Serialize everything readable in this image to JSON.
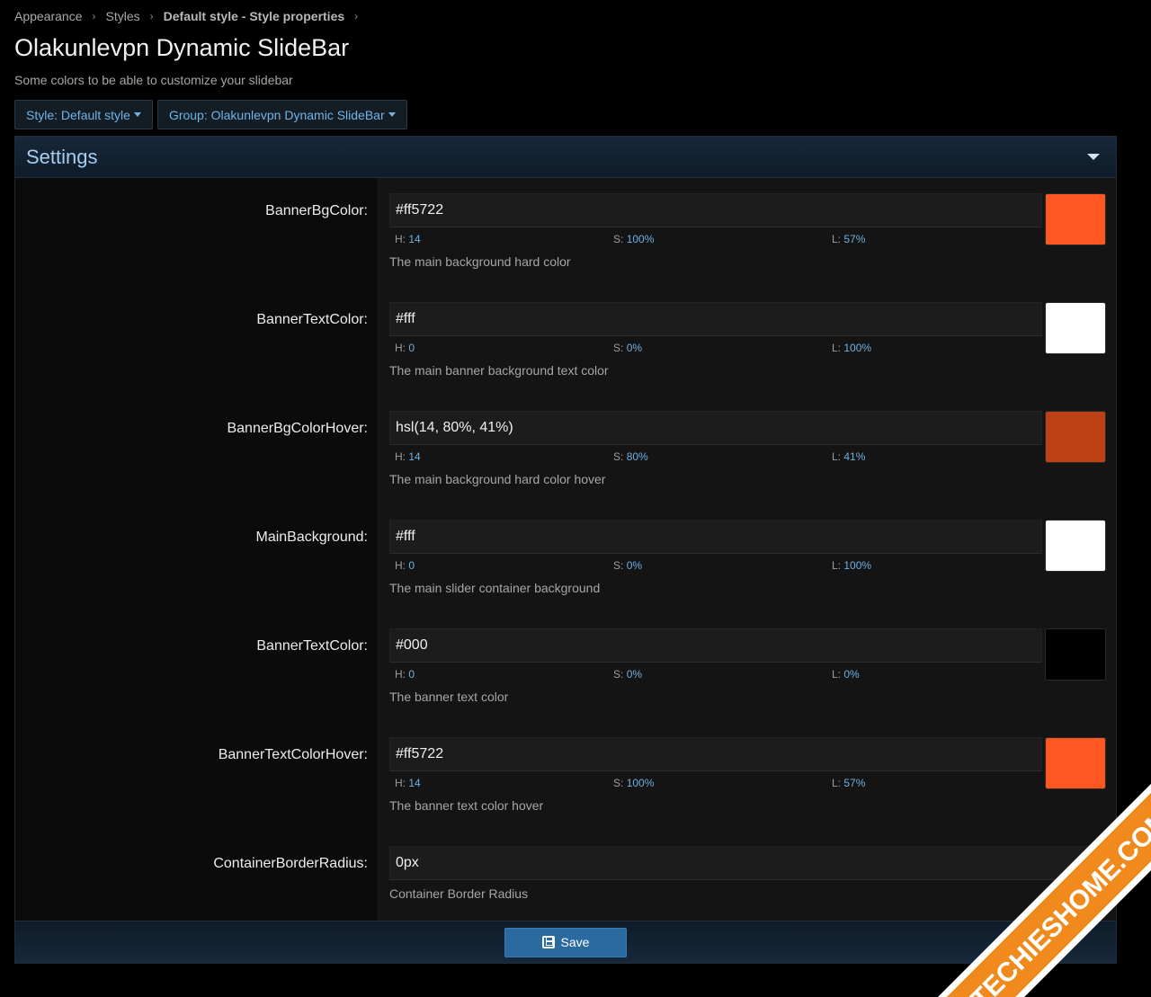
{
  "breadcrumb": {
    "items": [
      "Appearance",
      "Styles",
      "Default style - Style properties"
    ]
  },
  "page": {
    "title": "Olakunlevpn Dynamic SlideBar",
    "description": "Some colors to be able to customize your slidebar"
  },
  "filters": {
    "style": "Style: Default style",
    "group": "Group: Olakunlevpn Dynamic SlideBar"
  },
  "settings": {
    "title": "Settings",
    "rows": [
      {
        "label": "BannerBgColor:",
        "value": "#ff5722",
        "h_label": "H:",
        "h": "14",
        "s_label": "S:",
        "s": "100%",
        "l_label": "L:",
        "l": "57%",
        "swatch": "#ff5722",
        "explain": "The main background hard color"
      },
      {
        "label": "BannerTextColor:",
        "value": "#fff",
        "h_label": "H:",
        "h": "0",
        "s_label": "S:",
        "s": "0%",
        "l_label": "L:",
        "l": "100%",
        "swatch": "#ffffff",
        "explain": "The main banner background text color"
      },
      {
        "label": "BannerBgColorHover:",
        "value": "hsl(14, 80%, 41%)",
        "h_label": "H:",
        "h": "14",
        "s_label": "S:",
        "s": "80%",
        "l_label": "L:",
        "l": "41%",
        "swatch": "#bd4115",
        "explain": "The main background hard color hover"
      },
      {
        "label": "MainBackground:",
        "value": "#fff",
        "h_label": "H:",
        "h": "0",
        "s_label": "S:",
        "s": "0%",
        "l_label": "L:",
        "l": "100%",
        "swatch": "#ffffff",
        "explain": "The main slider container background"
      },
      {
        "label": "BannerTextColor:",
        "value": "#000",
        "h_label": "H:",
        "h": "0",
        "s_label": "S:",
        "s": "0%",
        "l_label": "L:",
        "l": "0%",
        "swatch": "#000000",
        "explain": "The banner text color"
      },
      {
        "label": "BannerTextColorHover:",
        "value": "#ff5722",
        "h_label": "H:",
        "h": "14",
        "s_label": "S:",
        "s": "100%",
        "l_label": "L:",
        "l": "57%",
        "swatch": "#ff5722",
        "explain": "The banner text color hover"
      },
      {
        "label": "ContainerBorderRadius:",
        "value": "0px",
        "explain": "Container Border Radius"
      }
    ],
    "save_label": "Save"
  },
  "watermark": {
    "text": "TECHIESHOME.COM",
    "color": "#f08a1c"
  },
  "icons": {
    "save": "save-icon",
    "collapse": "chevron-down-icon",
    "dropdown": "caret-down-icon"
  }
}
